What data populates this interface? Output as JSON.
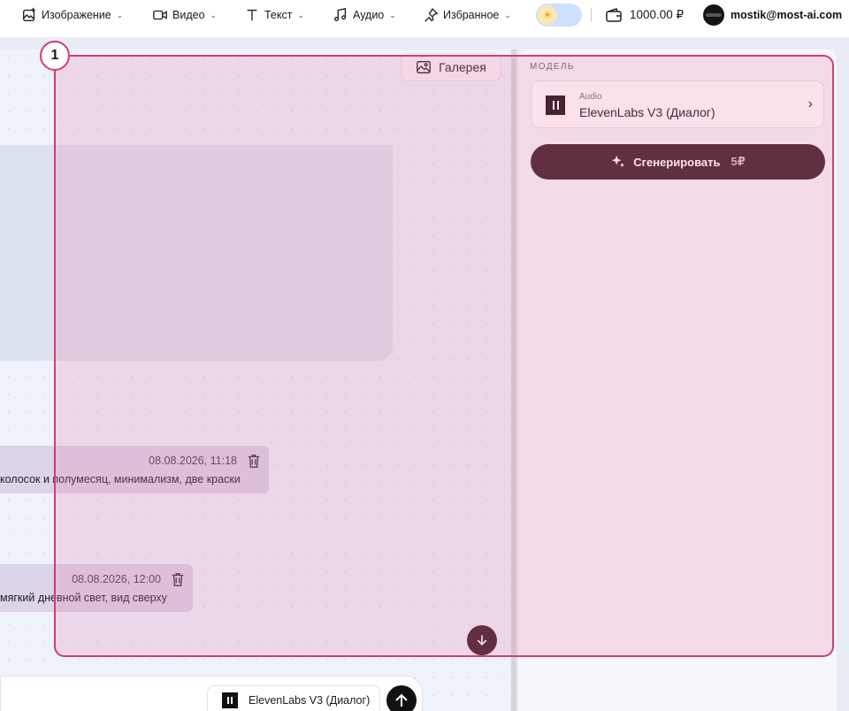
{
  "nav": {
    "items": [
      {
        "label": "Изображение",
        "icon": "image-plus-icon"
      },
      {
        "label": "Видео",
        "icon": "video-icon"
      },
      {
        "label": "Текст",
        "icon": "text-icon"
      },
      {
        "label": "Аудио",
        "icon": "music-icon"
      },
      {
        "label": "Избранное",
        "icon": "pin-icon"
      }
    ],
    "theme_icon": "sun-icon",
    "balance": "1000.00 ₽",
    "user_email": "mostik@most-ai.com"
  },
  "canvas": {
    "gallery_label": "Галерея",
    "messages": [
      {
        "timestamp": "08.08.2026, 11:18",
        "text": "колосок и полумесяц, минимализм, две краски"
      },
      {
        "timestamp": "08.08.2026, 12:00",
        "text": "мягкий дневной свет, вид сверху"
      }
    ]
  },
  "composer": {
    "model_chip": "ElevenLabs V3 (Диалог)"
  },
  "panel": {
    "section_label": "МОДЕЛЬ",
    "model_category": "Audio",
    "model_name": "ElevenLabs V3 (Диалог)",
    "generate_label": "Сгенерировать",
    "generate_price": "5₽"
  },
  "overlay": {
    "badge_number": "1",
    "accent_color": "#d23c73"
  },
  "colors": {
    "primary_dark": "#3a1d27",
    "message_bg": "#dcd4e8"
  }
}
